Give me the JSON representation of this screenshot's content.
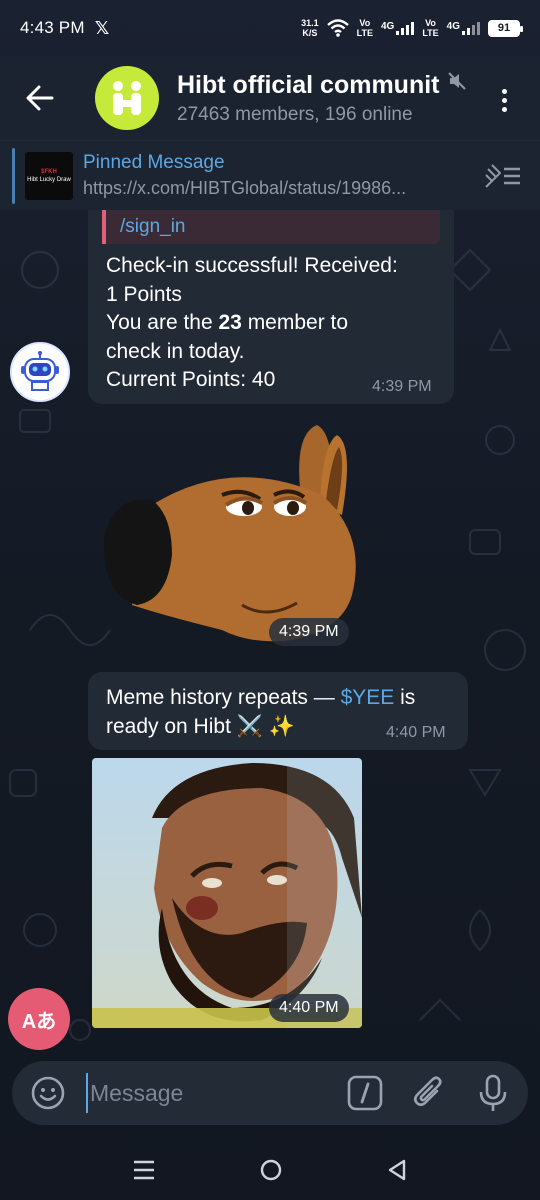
{
  "status_bar": {
    "time": "4:43 PM",
    "x_icon_label": "𝕏",
    "net_speed_value": "31.1",
    "net_speed_unit": "K/S",
    "volte1": "Vo",
    "volte1_sub": "LTE",
    "net1": "4G",
    "volte2": "Vo",
    "volte2_sub": "LTE",
    "net2": "4G",
    "battery": "91"
  },
  "header": {
    "title": "Hibt official communit",
    "subtitle": "27463 members, 196 online"
  },
  "pinned": {
    "title": "Pinned Message",
    "url": "https://x.com/HIBTGlobal/status/19986...",
    "thumb_line1": "$FKH",
    "thumb_line2": "Hibt Lucky Draw"
  },
  "messages": {
    "m1": {
      "reply_command": "/sign_in",
      "line1": "Check-in successful! Received:",
      "line2": "1 Points",
      "line3_pre": "You are the ",
      "line3_bold": "23",
      "line3_post": " member to",
      "line4": "check in today.",
      "line5": "Current Points: 40",
      "time": "4:39 PM"
    },
    "sticker": {
      "time": "4:39 PM"
    },
    "m2": {
      "text_pre": "Meme history repeats — ",
      "ticker": "$YEE",
      "text_post": " is",
      "line2": "ready on Hibt ⚔️ ✨",
      "time": "4:40 PM"
    },
    "photo": {
      "time": "4:40 PM"
    }
  },
  "translate_button": "Aあ",
  "input": {
    "placeholder": "Message"
  },
  "colors": {
    "accent": "#5aa9e6",
    "bubble": "#222a36",
    "group_avatar": "#c6ea3a",
    "translate": "#e65b74"
  }
}
